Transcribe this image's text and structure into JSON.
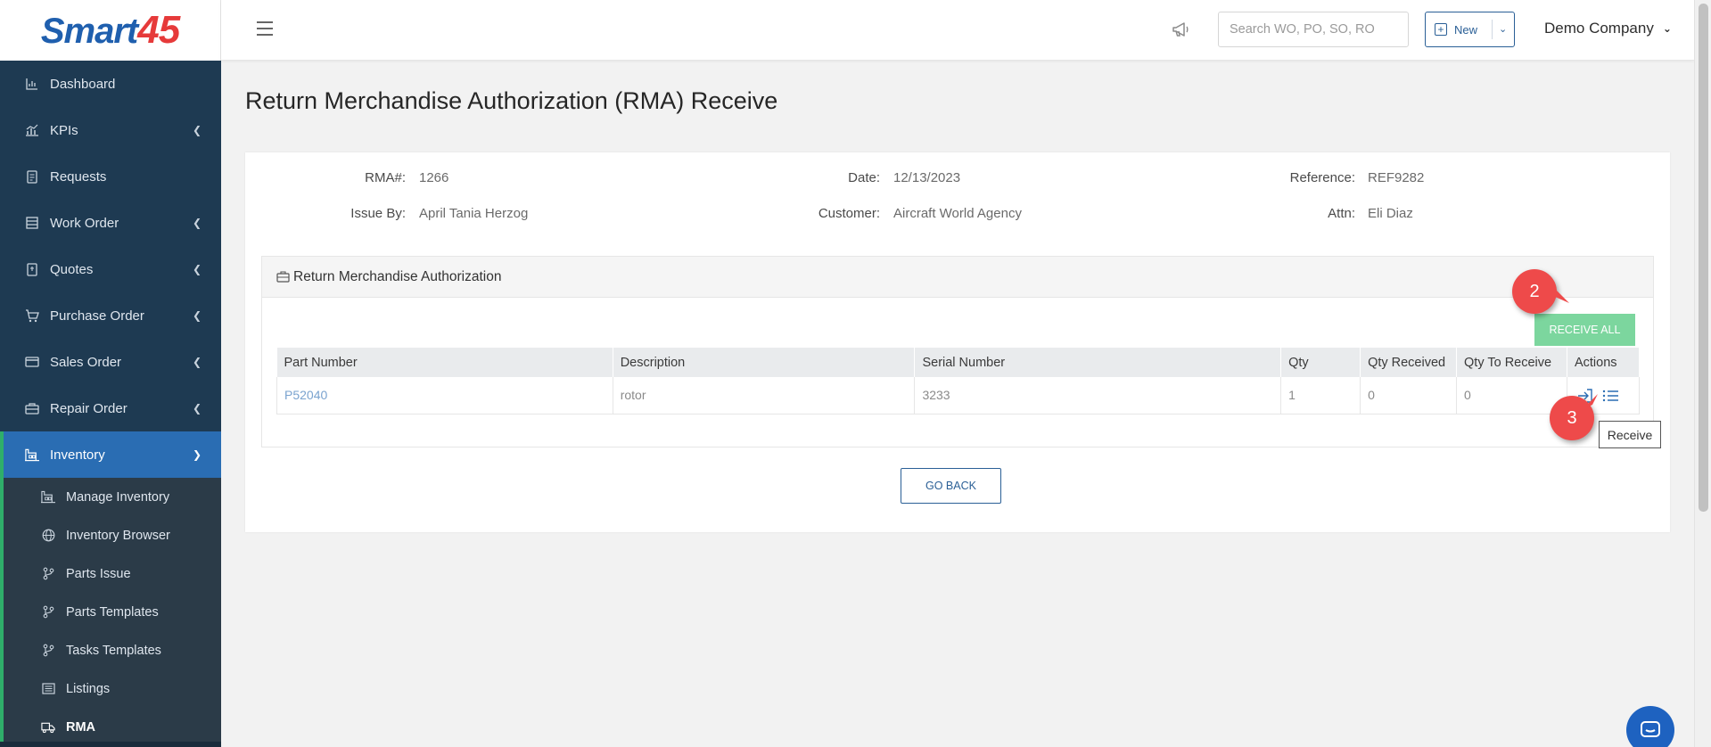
{
  "app": {
    "logo_text": "Smart",
    "logo_number": "45"
  },
  "topbar": {
    "search_placeholder": "Search WO, PO, SO, RO",
    "new_label": "New",
    "company": "Demo Company"
  },
  "sidebar": {
    "items": [
      {
        "label": "Dashboard",
        "icon": "chart-icon",
        "chevron": false
      },
      {
        "label": "KPIs",
        "icon": "kpi-icon",
        "chevron": true
      },
      {
        "label": "Requests",
        "icon": "document-icon",
        "chevron": false
      },
      {
        "label": "Work Order",
        "icon": "list-icon",
        "chevron": true
      },
      {
        "label": "Quotes",
        "icon": "quote-icon",
        "chevron": true
      },
      {
        "label": "Purchase Order",
        "icon": "cart-icon",
        "chevron": true
      },
      {
        "label": "Sales Order",
        "icon": "card-icon",
        "chevron": true
      },
      {
        "label": "Repair Order",
        "icon": "toolbox-icon",
        "chevron": true
      },
      {
        "label": "Inventory",
        "icon": "warehouse-icon",
        "chevron": true
      }
    ],
    "sub_items": [
      {
        "label": "Manage Inventory",
        "icon": "warehouse-icon"
      },
      {
        "label": "Inventory Browser",
        "icon": "globe-icon"
      },
      {
        "label": "Parts Issue",
        "icon": "branch-icon"
      },
      {
        "label": "Parts Templates",
        "icon": "branch-icon"
      },
      {
        "label": "Tasks Templates",
        "icon": "branch-icon"
      },
      {
        "label": "Listings",
        "icon": "listing-icon"
      },
      {
        "label": "RMA",
        "icon": "truck-icon"
      }
    ]
  },
  "page": {
    "title": "Return Merchandise Authorization (RMA) Receive"
  },
  "info": {
    "rma_label": "RMA#:",
    "rma_value": "1266",
    "date_label": "Date:",
    "date_value": "12/13/2023",
    "reference_label": "Reference:",
    "reference_value": "REF9282",
    "issue_by_label": "Issue By:",
    "issue_by_value": "April Tania Herzog",
    "customer_label": "Customer:",
    "customer_value": "Aircraft World Agency",
    "attn_label": "Attn:",
    "attn_value": "Eli Diaz"
  },
  "panel": {
    "title": "Return Merchandise Authorization",
    "receive_all_label": "RECEIVE ALL",
    "columns": [
      "Part Number",
      "Description",
      "Serial Number",
      "Qty",
      "Qty Received",
      "Qty To Receive",
      "Actions"
    ],
    "rows": [
      {
        "part_number": "P52040",
        "description": "rotor",
        "serial_number": "3233",
        "qty": "1",
        "qty_received": "0",
        "qty_to_receive": "0"
      }
    ]
  },
  "go_back_label": "GO BACK",
  "annotations": {
    "marker_2": "2",
    "marker_3": "3",
    "tooltip": "Receive"
  },
  "colors": {
    "sidebar_bg": "#1e3a52",
    "active_bg": "#2a6db3",
    "accent_green": "#2fae6a",
    "receive_all_bg": "#7cd69e",
    "primary_blue": "#2a5f96",
    "marker_red": "#ee4a4a"
  }
}
